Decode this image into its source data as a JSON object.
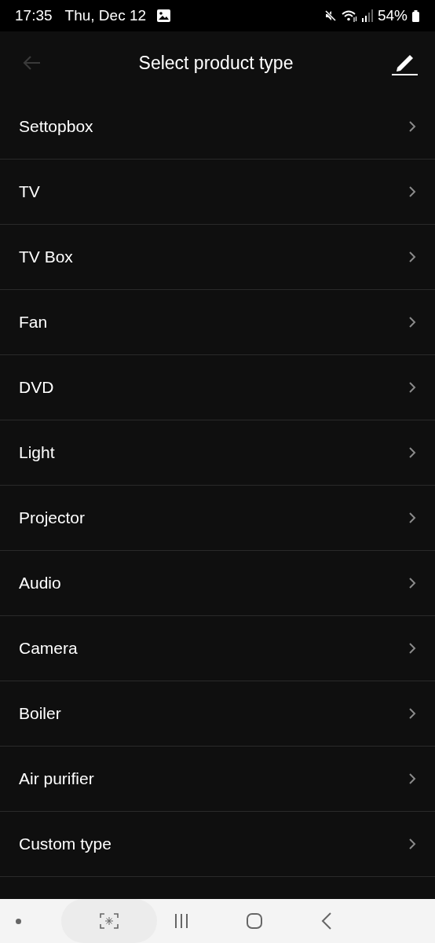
{
  "status_bar": {
    "time": "17:35",
    "date": "Thu, Dec 12",
    "battery": "54%"
  },
  "header": {
    "title": "Select product type",
    "back_disabled": true
  },
  "items": [
    {
      "label": "Settopbox"
    },
    {
      "label": "TV"
    },
    {
      "label": "TV Box"
    },
    {
      "label": "Fan"
    },
    {
      "label": "DVD"
    },
    {
      "label": "Light"
    },
    {
      "label": "Projector"
    },
    {
      "label": "Audio"
    },
    {
      "label": "Camera"
    },
    {
      "label": "Boiler"
    },
    {
      "label": "Air purifier"
    },
    {
      "label": "Custom type"
    }
  ]
}
